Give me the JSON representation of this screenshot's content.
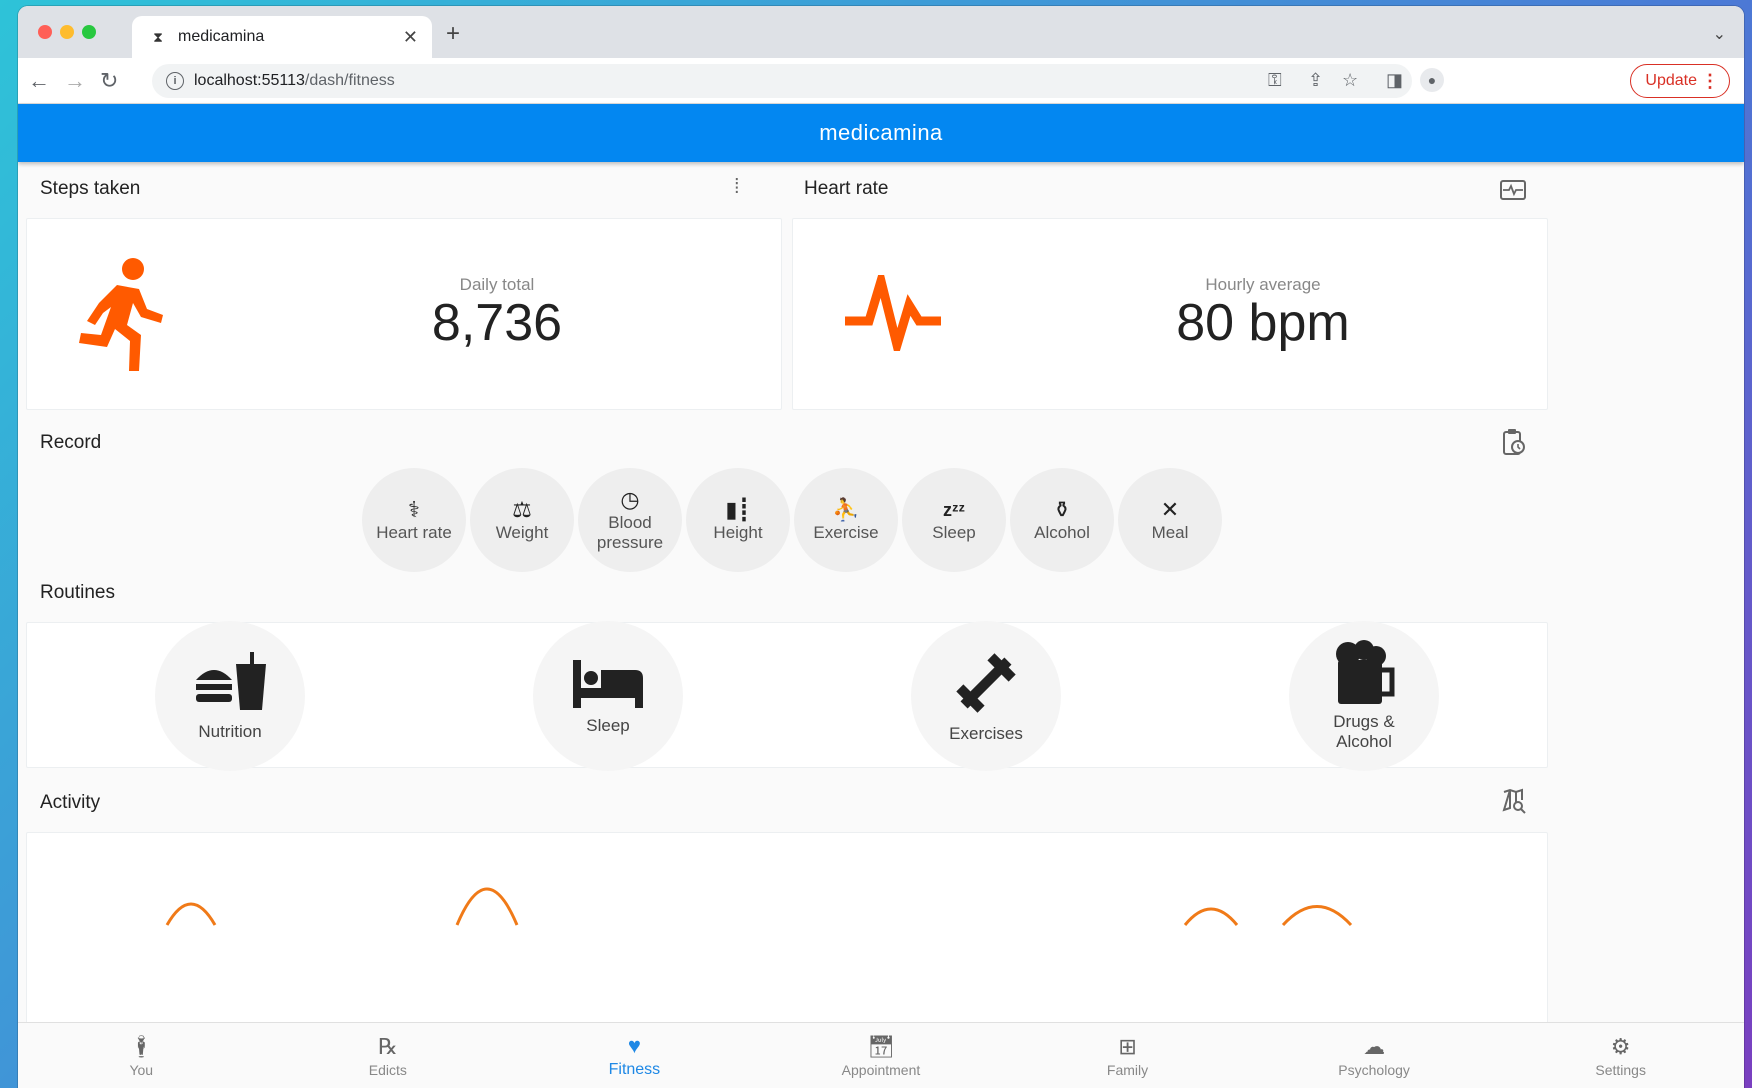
{
  "browser": {
    "tab_title": "medicamina",
    "url_host": "localhost:55113",
    "url_path": "/dash/fitness",
    "update_label": "Update",
    "traffic_colors": [
      "#ff5f57",
      "#febc2e",
      "#28c840"
    ]
  },
  "app": {
    "title": "medicamina",
    "accent": "#0387f1",
    "highlight": "#ff5a00"
  },
  "steps": {
    "title": "Steps taken",
    "caption": "Daily total",
    "value": "8,736",
    "header_icon": "footprints-icon",
    "main_icon": "running-person-icon"
  },
  "heart": {
    "title": "Heart rate",
    "caption": "Hourly average",
    "value": "80 bpm",
    "header_icon": "monitor-heart-icon",
    "main_icon": "heartbeat-pulse-icon"
  },
  "record": {
    "title": "Record",
    "header_icon": "clipboard-clock-icon",
    "items": [
      {
        "label": "Heart rate",
        "icon": "stethoscope-icon"
      },
      {
        "label": "Weight",
        "icon": "scale-icon"
      },
      {
        "label": "Blood pressure",
        "icon": "gauge-icon"
      },
      {
        "label": "Height",
        "icon": "height-icon"
      },
      {
        "label": "Exercise",
        "icon": "weightlifter-icon"
      },
      {
        "label": "Sleep",
        "icon": "zzz-icon"
      },
      {
        "label": "Alcohol",
        "icon": "bottles-icon"
      },
      {
        "label": "Meal",
        "icon": "fork-knife-icon"
      }
    ]
  },
  "routines": {
    "title": "Routines",
    "items": [
      {
        "label": "Nutrition",
        "icon": "burger-drink-icon"
      },
      {
        "label": "Sleep",
        "icon": "bed-icon"
      },
      {
        "label": "Exercises",
        "icon": "dumbbell-icon"
      },
      {
        "label": "Drugs & Alcohol",
        "icon": "beer-mug-icon"
      }
    ]
  },
  "activity": {
    "title": "Activity",
    "header_icon": "map-search-icon"
  },
  "bottom_nav": [
    {
      "label": "You",
      "icon": "person-icon",
      "active": false
    },
    {
      "label": "Edicts",
      "icon": "rx-icon",
      "active": false
    },
    {
      "label": "Fitness",
      "icon": "heart-pulse-icon",
      "active": true
    },
    {
      "label": "Appointment",
      "icon": "calendar-clock-icon",
      "active": false
    },
    {
      "label": "Family",
      "icon": "family-tree-icon",
      "active": false
    },
    {
      "label": "Psychology",
      "icon": "brain-icon",
      "active": false
    },
    {
      "label": "Settings",
      "icon": "gear-icon",
      "active": false
    }
  ]
}
